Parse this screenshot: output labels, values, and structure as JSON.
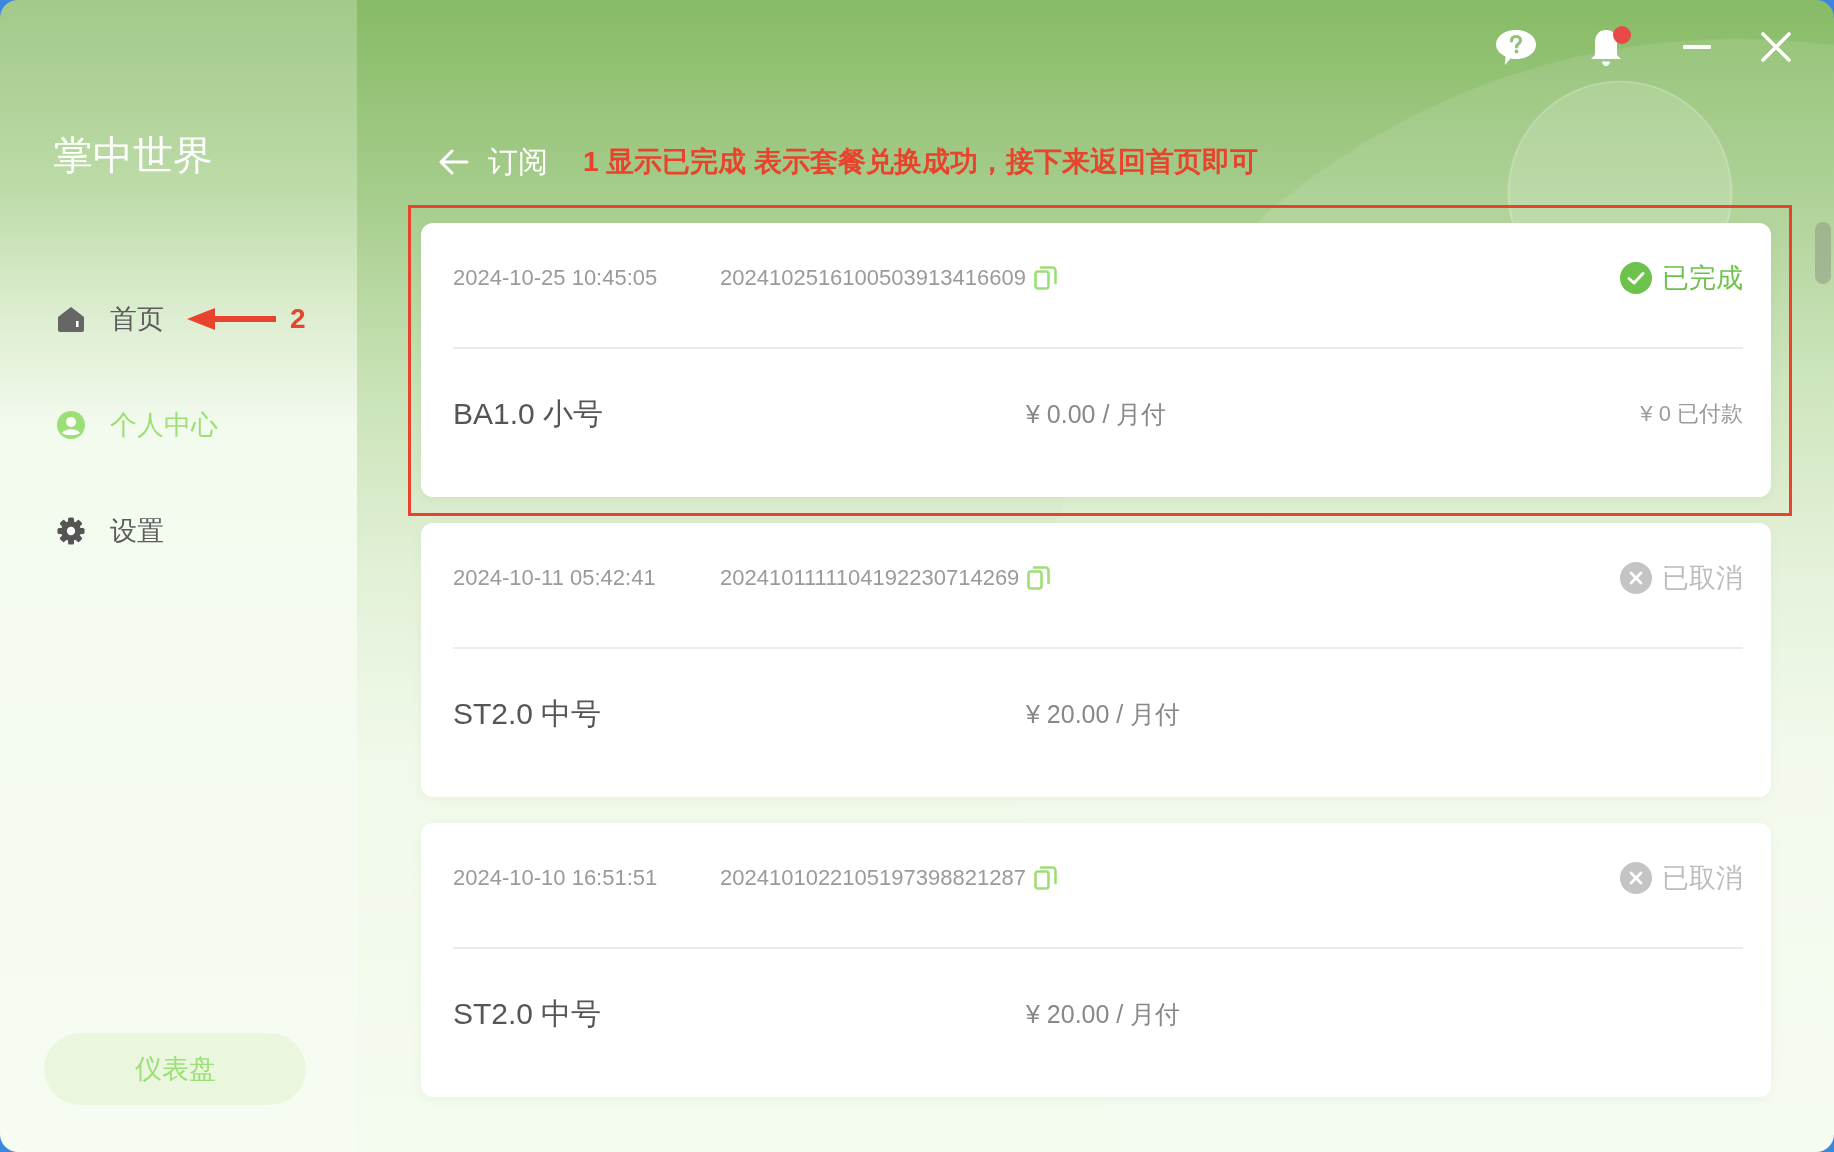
{
  "toolbar": {
    "unread_notifications": true
  },
  "sidebar": {
    "title": "掌中世界",
    "items": [
      {
        "label": "首页",
        "selected": false,
        "callout": "2"
      },
      {
        "label": "个人中心",
        "selected": true
      },
      {
        "label": "设置",
        "selected": false
      }
    ],
    "dashboard_button": "仪表盘"
  },
  "header": {
    "title": "订阅",
    "callout": "1 显示已完成 表示套餐兑换成功，接下来返回首页即可"
  },
  "orders": [
    {
      "time": "2024-10-25 10:45:05",
      "number": "2024102516100503913416609",
      "status": {
        "kind": "completed",
        "label": "已完成"
      },
      "plan": "BA1.0 小号",
      "price": "¥ 0.00 / 月付",
      "paid": "¥ 0 已付款",
      "highlighted": true
    },
    {
      "time": "2024-10-11 05:42:41",
      "number": "2024101111104192230714269",
      "status": {
        "kind": "cancelled",
        "label": "已取消"
      },
      "plan": "ST2.0 中号",
      "price": "¥ 20.00 / 月付",
      "highlighted": false
    },
    {
      "time": "2024-10-10 16:51:51",
      "number": "2024101022105197398821287",
      "status": {
        "kind": "cancelled",
        "label": "已取消"
      },
      "plan": "ST2.0 中号",
      "price": "¥ 20.00 / 月付",
      "highlighted": false
    }
  ]
}
